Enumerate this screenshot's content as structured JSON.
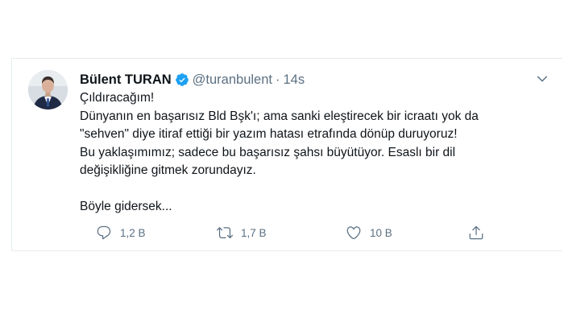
{
  "tweet": {
    "display_name": "Bülent TURAN",
    "handle": "@turanbulent",
    "separator": "·",
    "time": "14s",
    "lines": [
      "Çıldıracağım!",
      "Dünyanın en başarısız Bld Bşk'ı; ama sanki eleştirecek bir icraatı yok da",
      "\"sehven\" diye itiraf ettiği bir yazım hatası etrafında dönüp duruyoruz!",
      "Bu yaklaşımımız; sadece bu başarısız şahsı büyütüyor. Esaslı bir dil",
      "değişikliğine gitmek zorundayız."
    ],
    "closing_line": "Böyle gidersek...",
    "actions": {
      "reply_count": "1,2 B",
      "retweet_count": "1,7 B",
      "like_count": "10 B"
    }
  },
  "icons": {
    "verified": "verified-badge-icon",
    "more": "caret-down-icon",
    "reply": "reply-icon",
    "retweet": "retweet-icon",
    "like": "heart-icon",
    "share": "share-icon"
  },
  "colors": {
    "text": "#0f1419",
    "secondary": "#5b7083",
    "verified": "#1da1f2",
    "border": "#e6ecf0"
  }
}
